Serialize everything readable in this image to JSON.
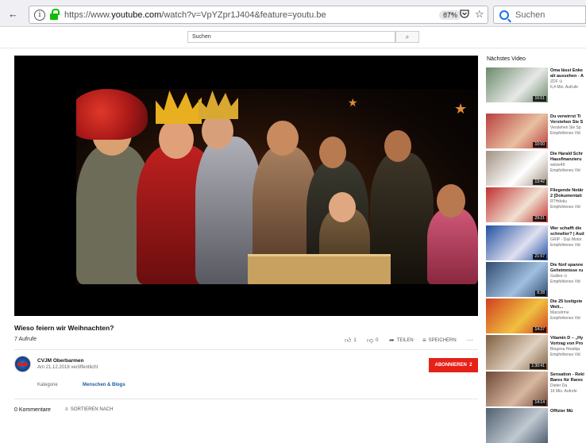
{
  "browser": {
    "url_prefix": "https://www.",
    "url_domain": "youtube.com",
    "url_path": "/watch?v=VpYZpr1J404&feature=youtu.be",
    "zoom": "67%",
    "search_placeholder": "Suchen",
    "info_icon": "i"
  },
  "youtube": {
    "search_placeholder": "Suchen",
    "search_button_icon": "⌕"
  },
  "video": {
    "title": "Wieso feiern wir Weihnachten?",
    "views": "7 Aufrufe",
    "likes": "1",
    "dislikes": "0",
    "share_label": "TEILEN",
    "save_label": "SPEICHERN",
    "more_label": "···"
  },
  "channel": {
    "name": "CVJM Oberbarmen",
    "date": "Am 21.12.2018 veröffentlicht",
    "subscribe_label": "ABONNIEREN",
    "subscriber_count": "2",
    "category_label": "Kategorie",
    "category_value": "Menschen & Blogs"
  },
  "comments": {
    "count_label": "0 Kommentare",
    "sort_label": "SORTIEREN NACH"
  },
  "sidebar": {
    "next_label": "Nächstes Video",
    "items": [
      {
        "title1": "Oma lässt Enke",
        "title2": "alt aussehen - A",
        "channel": "ZDF ⊙",
        "views": "6,4 Mio. Aufrufe",
        "duration": "16:51",
        "bg": "#6a8a6a",
        "accent": "#e8e8e8"
      },
      {
        "title1": "Du verwirrst Ti",
        "title2": "Verstehen Sie S",
        "channel": "Verstehen Sie Sp",
        "views": "Empfohlenes Vid",
        "duration": "10:00",
        "bg": "#b84040",
        "accent": "#e8c0a0"
      },
      {
        "title1": "Die Harald Schr",
        "title2": "Hausfinanzieru",
        "channel": "welze49",
        "views": "Empfohlenes Vid",
        "duration": "13:42",
        "bg": "#a09080",
        "accent": "#ffffff"
      },
      {
        "title1": "Fliegende Notär",
        "title2": "2 [Dokumentati",
        "channel": "RTHdoku",
        "views": "Empfohlenes Vid",
        "duration": "29:21",
        "bg": "#c03030",
        "accent": "#f0e0d0"
      },
      {
        "title1": "Wer schafft die",
        "title2": "schneller? | Aud",
        "channel": "GRIP - Das Motor",
        "views": "Empfohlenes Vid",
        "duration": "21:57",
        "bg": "#2050a0",
        "accent": "#e0e0f0"
      },
      {
        "title1": "Die fünf spanne",
        "title2": "Geheimnisse ru",
        "channel": "Galileo ⊙",
        "views": "Empfohlenes Vid",
        "duration": "8:28",
        "bg": "#304a70",
        "accent": "#a0c0e0"
      },
      {
        "title1": "Die 25 lustigste",
        "title2": "Welt...",
        "channel": "Marcelrme",
        "views": "Empfohlenes Vid",
        "duration": "14:27",
        "bg": "#d04020",
        "accent": "#f0c040"
      },
      {
        "title1": "Vitamin D – „Hy",
        "title2": "Vortrag von Pro",
        "channel": "Biogena Headqu",
        "views": "Empfohlenes Vid",
        "duration": "1:30:41",
        "bg": "#806040",
        "accent": "#e0d0c0"
      },
      {
        "title1": "Sensation - Reki",
        "title2": "Bares für Rares",
        "channel": "Dieter Da",
        "views": "16 Mio. Aufrufe",
        "duration": "14:14",
        "bg": "#704838",
        "accent": "#d8b8a0"
      },
      {
        "title1": "Offizier Mü",
        "title2": "",
        "channel": "",
        "views": "",
        "duration": "",
        "bg": "#506070",
        "accent": "#c0c8d0"
      }
    ]
  }
}
